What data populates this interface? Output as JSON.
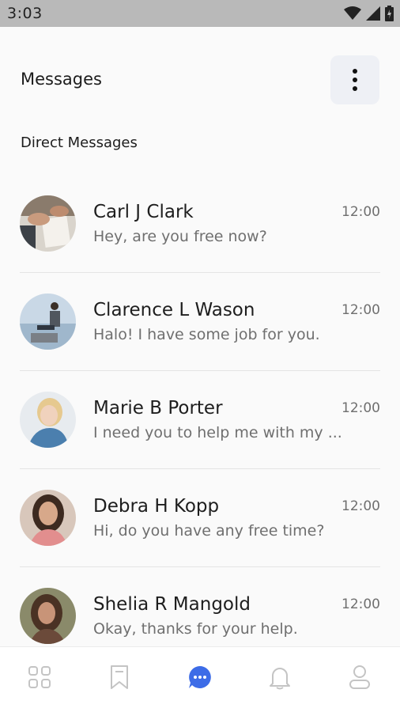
{
  "status_bar": {
    "time": "3:03",
    "icons": [
      "wifi-icon",
      "signal-icon",
      "battery-icon"
    ]
  },
  "header": {
    "title": "Messages",
    "menu_icon": "more-vertical-icon"
  },
  "section": {
    "title": "Direct Messages"
  },
  "conversations": [
    {
      "name": "Carl J Clark",
      "preview": "Hey, are you free now?",
      "time": "12:00"
    },
    {
      "name": "Clarence L Wason",
      "preview": "Halo! I have some job for you.",
      "time": "12:00"
    },
    {
      "name": "Marie B Porter",
      "preview": "I need you to help me with my ...",
      "time": "12:00"
    },
    {
      "name": "Debra H Kopp",
      "preview": "Hi, do you have any free time?",
      "time": "12:00"
    },
    {
      "name": "Shelia R Mangold",
      "preview": "Okay, thanks for your help.",
      "time": "12:00"
    }
  ],
  "bottom_nav": {
    "items": [
      "grid-icon",
      "bookmark-icon",
      "chat-icon",
      "bell-icon",
      "profile-icon"
    ],
    "active": "chat-icon"
  },
  "colors": {
    "accent": "#3d6ce7",
    "icon_inactive": "#c4c4c4",
    "status_bar": "#b9b9b9",
    "background": "#fafafa"
  }
}
